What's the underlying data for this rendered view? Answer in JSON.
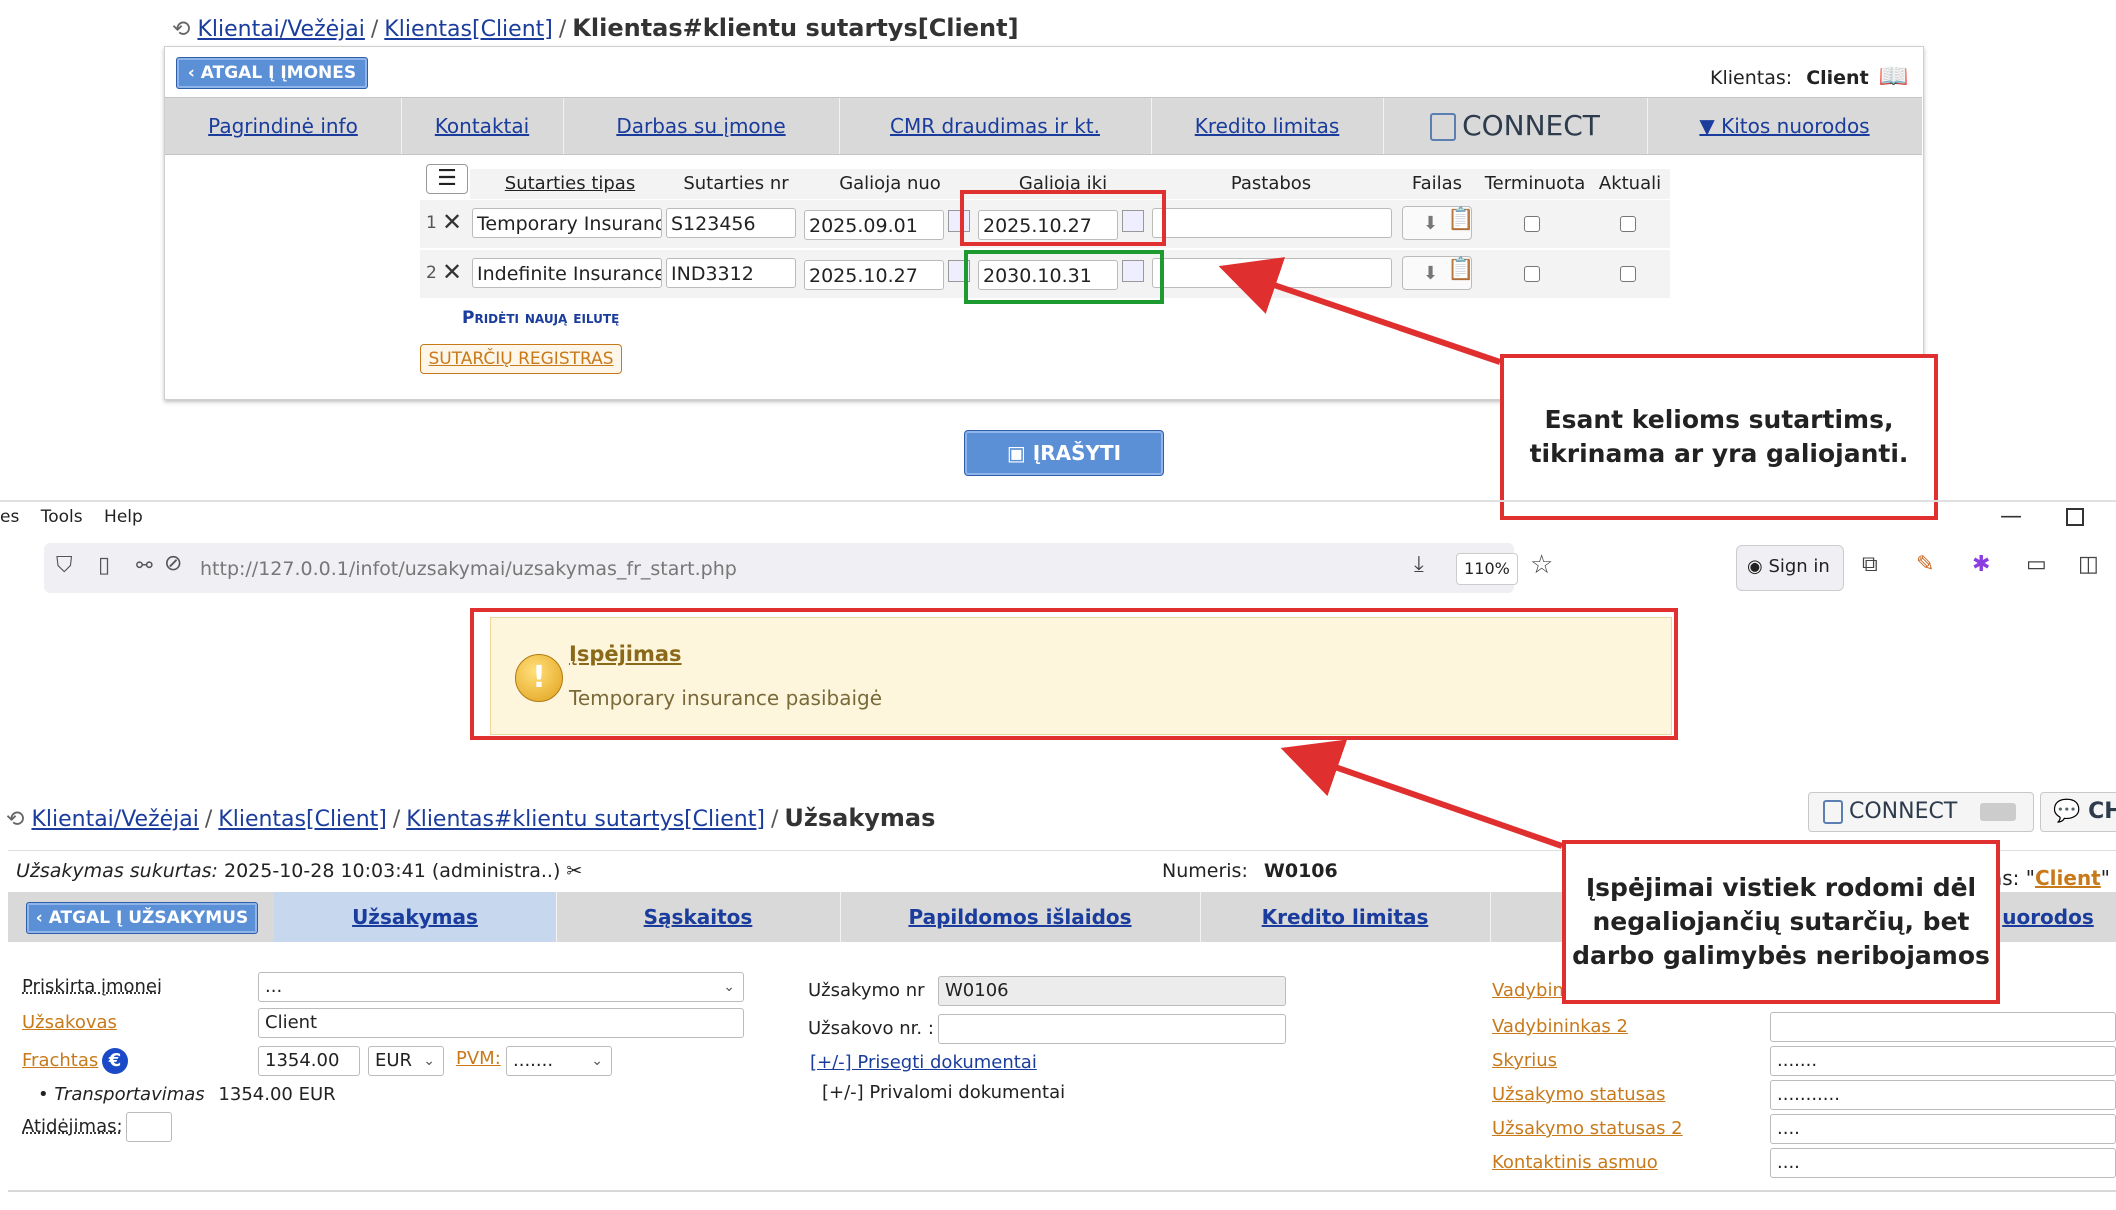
{
  "top": {
    "breadcrumb": [
      "Klientai/Vežėjai",
      "Klientas[Client]"
    ],
    "breadcrumb_current": "Klientas#klientu sutartys[Client]",
    "back_button": "‹ ATGAL Į ĮMONES",
    "client_label": "Klientas:",
    "client_value": "Client",
    "nav": [
      "Pagrindinė info",
      "Kontaktai",
      "Darbas su įmone",
      "CMR draudimas ir kt.",
      "Kredito limitas",
      "CONNECT",
      "▼ Kitos nuorodos"
    ],
    "table": {
      "headers": [
        "Sutarties tipas",
        "Sutarties nr",
        "Galioja nuo",
        "Galioja iki",
        "Pastabos",
        "Failas",
        "Terminuota",
        "Aktuali"
      ],
      "rows": [
        {
          "num": "1",
          "type": "Temporary Insurance",
          "nr": "S123456",
          "from": "2025.09.01",
          "to": "2025.10.27",
          "notes": ""
        },
        {
          "num": "2",
          "type": "Indefinite Insurance",
          "nr": "IND3312",
          "from": "2025.10.27",
          "to": "2030.10.31",
          "notes": ""
        }
      ]
    },
    "add_row": "Pridėti naują eilutę",
    "registry": "SUTARČIŲ REGISTRAS",
    "save": "ĮRAŠYTI"
  },
  "annotations": {
    "a1": "Esant kelioms sutartims, tikrinama ar yra galiojanti.",
    "a2": "Įspėjimai vistiek rodomi dėl negaliojančių sutarčių, bet darbo galimybės neribojamos"
  },
  "browser": {
    "menu_cut": "es",
    "menu": [
      "Tools",
      "Help"
    ],
    "url_host": "http://127.0.0.1",
    "url_path": "/infot/uzsakymai/uzsakymas_fr_start.php",
    "zoom": "110%",
    "sign_in": "Sign in"
  },
  "warning": {
    "title": "Įspėjimas",
    "message": "Temporary insurance pasibaigė"
  },
  "order": {
    "breadcrumb": [
      "Klientai/Vežėjai",
      "Klientas[Client]",
      "Klientas#klientu sutartys[Client]"
    ],
    "breadcrumb_current": "Užsakymas",
    "connect": "CONNECT",
    "ch": "CH",
    "created_label": "Užsakymas sukurtas:",
    "created_value": "2025-10-28 10:03:41 (administra..)",
    "number_label": "Numeris:",
    "number_value": "W0106",
    "client_cut": "as: \"",
    "client_link": "Client",
    "client_end": "\"",
    "back_button": "‹ ATGAL Į UŽSAKYMUS",
    "tabs": [
      "Užsakymas",
      "Sąskaitos",
      "Papildomos išlaidos",
      "Kredito limitas"
    ],
    "tab_cut": "uorodos",
    "fields_left": {
      "assigned_label": "Priskirta įmonei",
      "assigned_value": "...",
      "customer_label": "Užsakovas",
      "customer_value": "Client",
      "freight_label": "Frachtas",
      "freight_value": "1354.00",
      "currency": "EUR",
      "vat_label": "PVM:",
      "vat_value": ".......",
      "transport_label": "Transportavimas",
      "transport_value": "1354.00 EUR",
      "delay_label": "Atidėjimas:"
    },
    "fields_mid": {
      "order_nr_label": "Užsakymo nr",
      "order_nr_value": "W0106",
      "customer_nr_label": "Užsakovo nr. :",
      "attached_docs": "[+/-] Prisegti dokumentai",
      "required_docs": "[+/-] Privalomi dokumentai"
    },
    "fields_right": {
      "manager_cut": "Vadybin",
      "manager2": "Vadybininkas 2",
      "dept": "Skyrius",
      "dept_value": ".......",
      "status": "Užsakymo statusas",
      "status_value": "...........",
      "status2": "Užsakymo statusas 2",
      "status2_value": "....",
      "contact": "Kontaktinis asmuo",
      "contact_value": "...."
    }
  }
}
